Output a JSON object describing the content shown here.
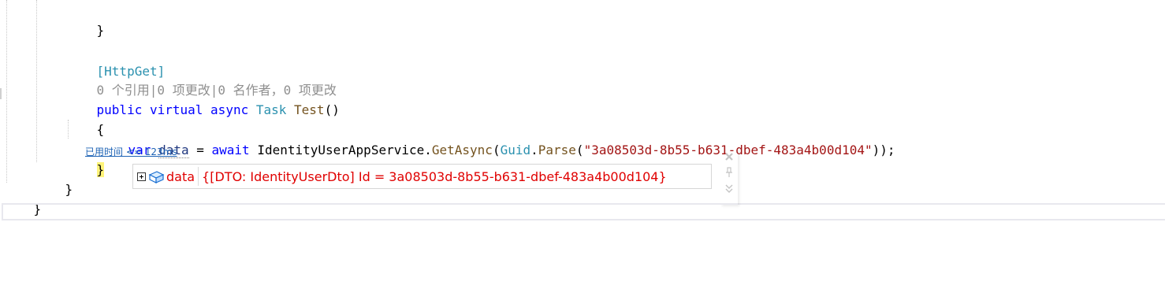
{
  "code": {
    "line_close_inner": "}",
    "attribute": "[HttpGet]",
    "codelens": "0 个引用|0 项更改|0 名作者，0 项更改",
    "sig_public": "public",
    "sig_virtual": "virtual",
    "sig_async": "async",
    "sig_return_type": "Task",
    "sig_method_name": "Test",
    "sig_parens": "()",
    "open_brace": "{",
    "stmt_var": "var",
    "stmt_varname": "data",
    "stmt_assign": " = ",
    "stmt_await": "await",
    "stmt_service": " IdentityUserAppService.",
    "stmt_getasync": "GetAsync",
    "stmt_paren_open": "(",
    "stmt_guid": "Guid",
    "stmt_dot": ".",
    "stmt_parse": "Parse",
    "stmt_paren_open2": "(",
    "stmt_string": "\"3a08503d-8b55-b631-dbef-483a4b00d104\"",
    "stmt_end": "));",
    "close_brace_method": "}",
    "close_brace_class": "}",
    "close_brace_ns": "}"
  },
  "perf_tip": "已用时间 <= 123ms",
  "datatip": {
    "name": "data",
    "value": "{[DTO: IdentityUserDto] Id = 3a08503d-8b55-b631-dbef-483a4b00d104}"
  },
  "icons": {
    "expand": "expand-plus-icon",
    "object": "object-icon",
    "close": "close-icon",
    "pin": "pin-icon",
    "comment": "expand-comment-icon"
  }
}
